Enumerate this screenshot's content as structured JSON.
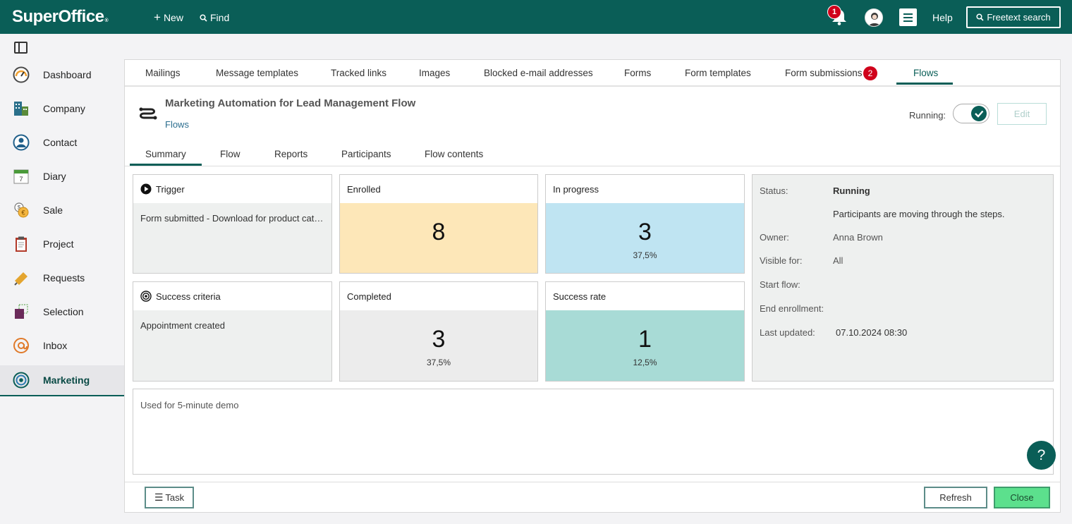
{
  "app": {
    "logo": "SuperOffice",
    "logo_reg": "®",
    "new_label": "New",
    "find_label": "Find",
    "notification_count": "1",
    "help_label": "Help",
    "freetext_label": "Freetext search",
    "brand_color": "#0a5e57"
  },
  "sidebar": {
    "items": [
      {
        "label": "Dashboard",
        "icon": "dashboard-gauge-icon"
      },
      {
        "label": "Company",
        "icon": "company-building-icon"
      },
      {
        "label": "Contact",
        "icon": "contact-person-icon"
      },
      {
        "label": "Diary",
        "icon": "diary-calendar-icon"
      },
      {
        "label": "Sale",
        "icon": "sale-coins-icon"
      },
      {
        "label": "Project",
        "icon": "project-clipboard-icon"
      },
      {
        "label": "Requests",
        "icon": "requests-ticket-icon"
      },
      {
        "label": "Selection",
        "icon": "selection-icon"
      },
      {
        "label": "Inbox",
        "icon": "inbox-at-icon"
      },
      {
        "label": "Marketing",
        "icon": "marketing-target-icon"
      }
    ],
    "active": "Marketing"
  },
  "tabs": {
    "items": [
      "Mailings",
      "Message templates",
      "Tracked links",
      "Images",
      "Blocked e-mail addresses",
      "Forms",
      "Form templates",
      "Form submissions",
      "Flows"
    ],
    "active": "Flows",
    "form_submissions_badge": "2"
  },
  "flow": {
    "title": "Marketing Automation for Lead Management Flow",
    "breadcrumb": "Flows",
    "running_label": "Running:",
    "running": true,
    "edit_label": "Edit"
  },
  "subtabs": {
    "items": [
      "Summary",
      "Flow",
      "Reports",
      "Participants",
      "Flow contents"
    ],
    "active": "Summary"
  },
  "cards": {
    "trigger": {
      "title": "Trigger",
      "text": "Form submitted - Download for product catalog"
    },
    "enrolled": {
      "title": "Enrolled",
      "value": "8",
      "color": "#fde7b8"
    },
    "in_progress": {
      "title": "In progress",
      "value": "3",
      "pct": "37,5%",
      "color": "#bfe4f2"
    },
    "success_criteria": {
      "title": "Success criteria",
      "text": "Appointment created"
    },
    "completed": {
      "title": "Completed",
      "value": "3",
      "pct": "37,5%",
      "color": "#ececec"
    },
    "success_rate": {
      "title": "Success rate",
      "value": "1",
      "pct": "12,5%",
      "color": "#a8dbd6"
    }
  },
  "status": {
    "status_label": "Status:",
    "status_value": "Running",
    "status_desc": "Participants are moving through the steps.",
    "owner_label": "Owner:",
    "owner_value": "Anna Brown",
    "visible_label": "Visible for:",
    "visible_value": "All",
    "start_label": "Start flow:",
    "end_label": "End enrollment:",
    "updated_label": "Last updated:",
    "updated_value": "07.10.2024 08:30"
  },
  "notes": "Used for 5-minute demo",
  "footer": {
    "task_label": "Task",
    "refresh_label": "Refresh",
    "close_label": "Close"
  },
  "help_fab": "?"
}
